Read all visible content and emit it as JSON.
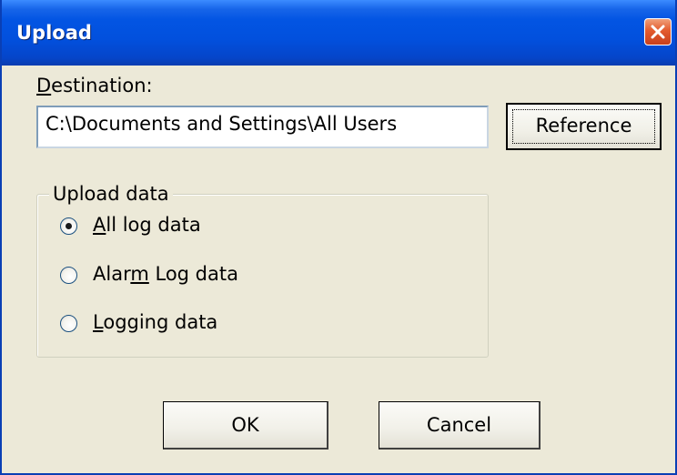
{
  "window": {
    "title": "Upload"
  },
  "destination": {
    "label_accel": "D",
    "label_rest": "estination:",
    "value": "C:\\Documents and Settings\\All Users",
    "reference_label": "Reference"
  },
  "upload_data": {
    "legend": "Upload data",
    "options": [
      {
        "pre": "",
        "accel": "A",
        "post": "ll log data",
        "selected": true
      },
      {
        "pre": "Alar",
        "accel": "m",
        "post": " Log data",
        "selected": false
      },
      {
        "pre": "",
        "accel": "L",
        "post": "ogging data",
        "selected": false
      }
    ]
  },
  "buttons": {
    "ok": "OK",
    "cancel": "Cancel"
  },
  "icons": {
    "close": "close-icon"
  },
  "colors": {
    "titlebar": "#0355e3",
    "dialog_bg": "#ece9d8",
    "close_btn": "#e35b2e"
  }
}
